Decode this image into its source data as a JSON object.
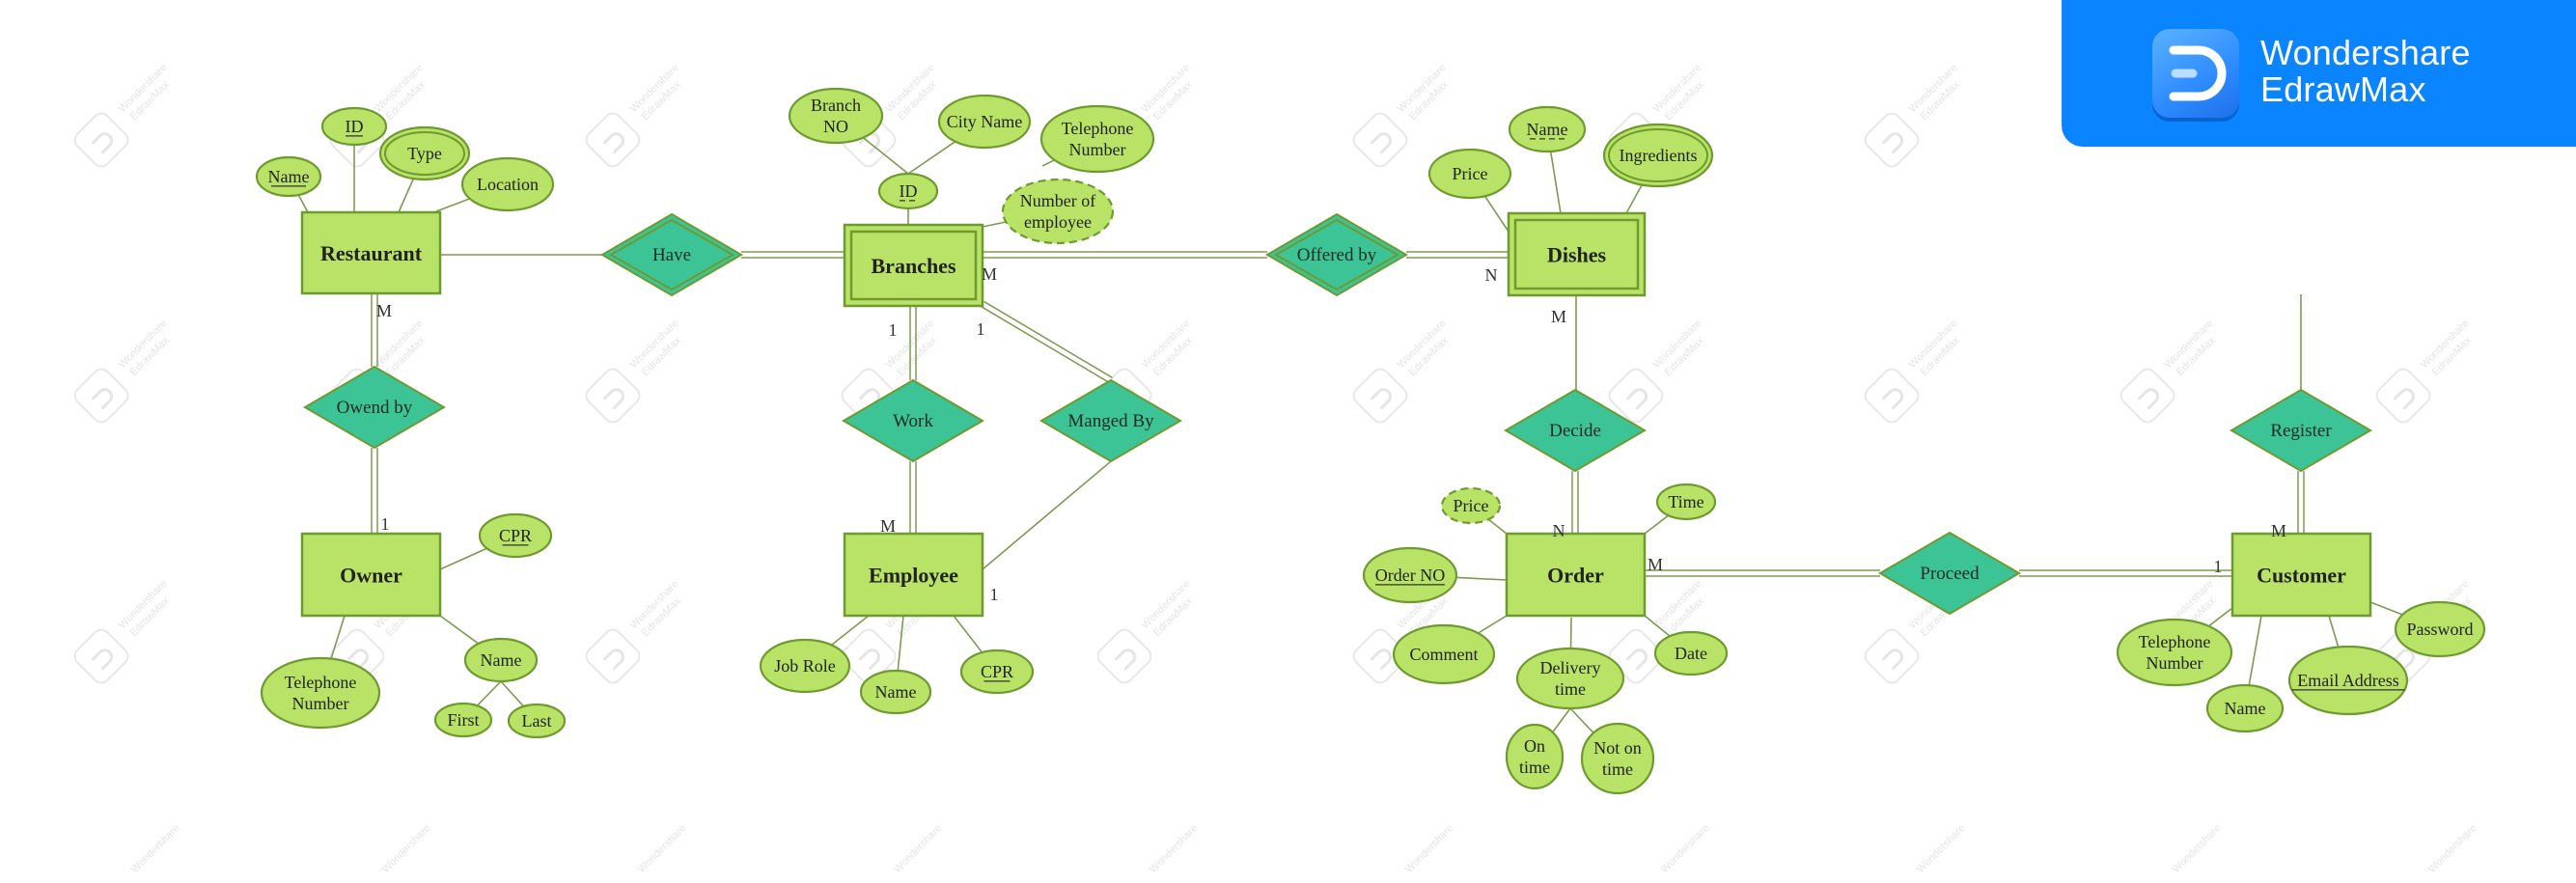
{
  "branding": {
    "line1": "Wondershare",
    "line2": "EdrawMax",
    "watermark_line1": "Wondershare",
    "watermark_line2": "EdrawMax",
    "colors": {
      "banner": "#0A84FF",
      "entity_fill": "#B8E366",
      "entity_stroke": "#6E9A30",
      "relationship_fill": "#3DC496",
      "relationship_stroke": "#6E9A30",
      "attribute_fill": "#B8E366",
      "attribute_stroke": "#6E9A30",
      "connector": "#7E9A52"
    }
  },
  "diagram": {
    "type": "ER diagram",
    "entities": [
      {
        "id": "restaurant",
        "label": "Restaurant",
        "weak": false
      },
      {
        "id": "branches",
        "label": "Branches",
        "weak": true
      },
      {
        "id": "dishes",
        "label": "Dishes",
        "weak": true
      },
      {
        "id": "owner",
        "label": "Owner",
        "weak": false
      },
      {
        "id": "employee",
        "label": "Employee",
        "weak": false
      },
      {
        "id": "order",
        "label": "Order",
        "weak": false
      },
      {
        "id": "customer",
        "label": "Customer",
        "weak": false
      }
    ],
    "relationships": [
      {
        "id": "have",
        "label": "Have",
        "identifying": true
      },
      {
        "id": "offered_by",
        "label": "Offered by",
        "identifying": true
      },
      {
        "id": "owend_by",
        "label": "Owend by",
        "identifying": false
      },
      {
        "id": "work",
        "label": "Work",
        "identifying": false
      },
      {
        "id": "manged_by",
        "label": "Manged By",
        "identifying": false
      },
      {
        "id": "decide",
        "label": "Decide",
        "identifying": false
      },
      {
        "id": "proceed",
        "label": "Proceed",
        "identifying": false
      },
      {
        "id": "register",
        "label": "Register",
        "identifying": false
      }
    ],
    "attributes": [
      {
        "id": "rest_name",
        "label": "Name",
        "key": "primary"
      },
      {
        "id": "rest_id",
        "label": "ID",
        "key": "primary"
      },
      {
        "id": "rest_type",
        "label": "Type",
        "kind": "multivalued"
      },
      {
        "id": "rest_location",
        "label": "Location"
      },
      {
        "id": "br_branchno",
        "label": [
          "Branch",
          "NO"
        ]
      },
      {
        "id": "br_cityname",
        "label": "City Name"
      },
      {
        "id": "br_id",
        "label": "ID",
        "key": "partial",
        "kind": "composite"
      },
      {
        "id": "br_tel",
        "label": [
          "Telephone",
          "Number"
        ]
      },
      {
        "id": "br_numemp",
        "label": [
          "Number of",
          "employee"
        ],
        "kind": "derived"
      },
      {
        "id": "dish_price",
        "label": "Price"
      },
      {
        "id": "dish_name",
        "label": "Name",
        "key": "partial"
      },
      {
        "id": "dish_ingr",
        "label": "Ingredients",
        "kind": "multivalued"
      },
      {
        "id": "own_cpr",
        "label": "CPR",
        "key": "primary"
      },
      {
        "id": "own_tel",
        "label": [
          "Telephone",
          "Number"
        ]
      },
      {
        "id": "own_name",
        "label": "Name",
        "kind": "composite"
      },
      {
        "id": "own_first",
        "label": "First"
      },
      {
        "id": "own_last",
        "label": "Last"
      },
      {
        "id": "emp_jobrole",
        "label": "Job Role"
      },
      {
        "id": "emp_name",
        "label": "Name"
      },
      {
        "id": "emp_cpr",
        "label": "CPR",
        "key": "primary"
      },
      {
        "id": "ord_price",
        "label": "Price",
        "kind": "derived"
      },
      {
        "id": "ord_time",
        "label": "Time"
      },
      {
        "id": "ord_no",
        "label": "Order NO",
        "key": "primary"
      },
      {
        "id": "ord_comment",
        "label": "Comment"
      },
      {
        "id": "ord_delivery",
        "label": [
          "Delivery",
          "time"
        ],
        "kind": "composite"
      },
      {
        "id": "ord_date",
        "label": "Date"
      },
      {
        "id": "ord_ontime",
        "label": [
          "On",
          "time"
        ]
      },
      {
        "id": "ord_notontime",
        "label": [
          "Not on",
          "time"
        ]
      },
      {
        "id": "cus_tel",
        "label": [
          "Telephone",
          "Number"
        ]
      },
      {
        "id": "cus_name",
        "label": "Name"
      },
      {
        "id": "cus_email",
        "label": "Email Address",
        "key": "primary"
      },
      {
        "id": "cus_password",
        "label": "Password"
      }
    ],
    "cardinalities": [
      {
        "id": "c_rest_owend",
        "label": "M"
      },
      {
        "id": "c_owner_owend",
        "label": "1"
      },
      {
        "id": "c_br_offered",
        "label": "M"
      },
      {
        "id": "c_dish_offered",
        "label": "N"
      },
      {
        "id": "c_br_work",
        "label": "1"
      },
      {
        "id": "c_br_manged",
        "label": "1"
      },
      {
        "id": "c_emp_work",
        "label": "M"
      },
      {
        "id": "c_emp_manged",
        "label": "1"
      },
      {
        "id": "c_dish_decide",
        "label": "M"
      },
      {
        "id": "c_ord_decide",
        "label": "N"
      },
      {
        "id": "c_ord_proceed",
        "label": "M"
      },
      {
        "id": "c_cus_proceed",
        "label": "1"
      },
      {
        "id": "c_cus_register",
        "label": "M"
      }
    ]
  }
}
